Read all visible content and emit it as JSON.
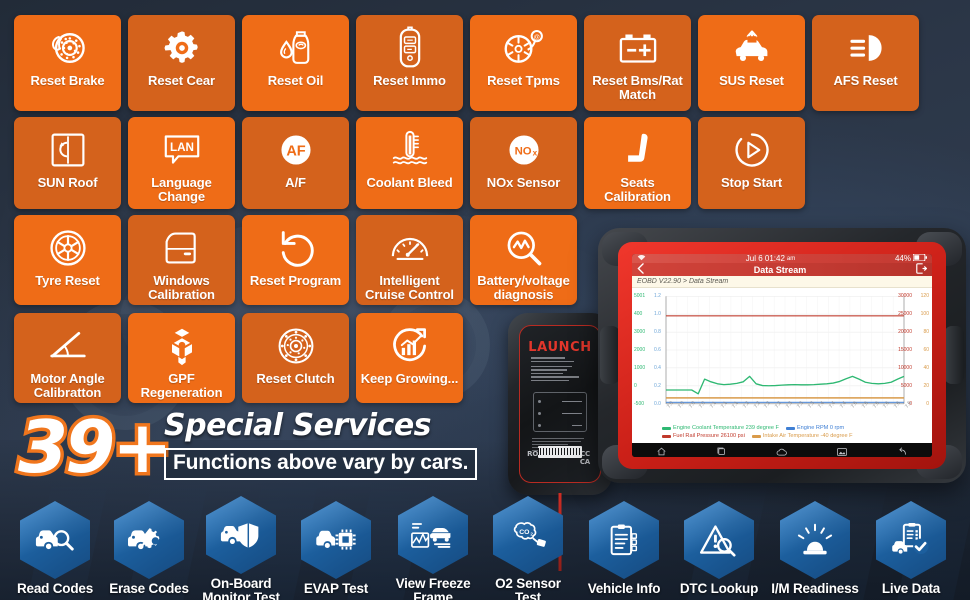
{
  "banner": {
    "count": "39+",
    "title": "Special Services",
    "note": "Functions above vary by cars."
  },
  "colors": {
    "tile_orange_light": "#ef6c17",
    "tile_orange_dark": "#d4621c",
    "hex_blue": "#1c5f9e",
    "brand_red": "#e2362b",
    "background_navy": "#2b3647"
  },
  "special_services": {
    "rows": [
      [
        {
          "label": "Reset Brake",
          "icon": "brake-disc-icon",
          "shade": "a"
        },
        {
          "label": "Reset Cear",
          "icon": "gear-icon",
          "shade": "b"
        },
        {
          "label": "Reset Oil",
          "icon": "oil-bottle-icon",
          "shade": "a"
        },
        {
          "label": "Reset Immo",
          "icon": "key-fob-icon",
          "shade": "b"
        },
        {
          "label": "Reset Tpms",
          "icon": "tyre-pressure-icon",
          "shade": "a"
        },
        {
          "label": "Reset Bms/Rat Match",
          "icon": "battery-icon",
          "shade": "b"
        },
        {
          "label": "SUS Reset",
          "icon": "suspension-car-icon",
          "shade": "a"
        },
        {
          "label": "AFS Reset",
          "icon": "headlight-icon",
          "shade": "b"
        }
      ],
      [
        {
          "label": "SUN Roof",
          "icon": "sunroof-icon",
          "shade": "b"
        },
        {
          "label": "Language Change",
          "icon": "lan-bubble-icon",
          "shade": "a"
        },
        {
          "label": "A/F",
          "icon": "af-circle-icon",
          "shade": "b"
        },
        {
          "label": "Coolant Bleed",
          "icon": "coolant-thermometer-icon",
          "shade": "a"
        },
        {
          "label": "NOx Sensor",
          "icon": "nox-circle-icon",
          "shade": "b"
        },
        {
          "label": "Seats Calibration",
          "icon": "car-seat-icon",
          "shade": "a"
        },
        {
          "label": "Stop Start",
          "icon": "stop-start-icon",
          "shade": "b"
        }
      ],
      [
        {
          "label": "Tyre Reset",
          "icon": "wheel-icon",
          "shade": "a"
        },
        {
          "label": "Windows Calibration",
          "icon": "car-door-icon",
          "shade": "b"
        },
        {
          "label": "Reset Program",
          "icon": "undo-arrow-icon",
          "shade": "a"
        },
        {
          "label": "Intelligent Cruise Control",
          "icon": "speedometer-icon",
          "shade": "b"
        },
        {
          "label": "Battery/voltage diagnosis",
          "icon": "magnifier-pulse-icon",
          "shade": "a"
        }
      ],
      [
        {
          "label": "Motor Angle Calibratton",
          "icon": "angle-icon",
          "shade": "b"
        },
        {
          "label": "GPF Regeneration",
          "icon": "cube-particles-icon",
          "shade": "a"
        },
        {
          "label": "Reset Clutch",
          "icon": "clutch-disc-icon",
          "shade": "b"
        },
        {
          "label": "Keep Growing...",
          "icon": "growth-chart-icon",
          "shade": "a"
        }
      ]
    ]
  },
  "obd_functions": [
    {
      "label": "Read Codes",
      "icon": "car-magnifier-icon"
    },
    {
      "label": "Erase Codes",
      "icon": "car-gear-icon"
    },
    {
      "label": "On-Board Monitor Test",
      "icon": "car-shield-icon"
    },
    {
      "label": "EVAP Test",
      "icon": "car-chip-icon"
    },
    {
      "label": "View Freeze Frame",
      "icon": "freeze-frame-icon"
    },
    {
      "label": "O2 Sensor Test",
      "icon": "co2-sensor-icon"
    },
    {
      "label": "Vehicle Info",
      "icon": "clipboard-icon"
    },
    {
      "label": "DTC Lookup",
      "icon": "warning-magnifier-icon"
    },
    {
      "label": "I/M Readiness",
      "icon": "beacon-lamp-icon"
    },
    {
      "label": "Live Data",
      "icon": "clipboard-check-car-icon"
    }
  ],
  "vci": {
    "brand": "LAUNCH",
    "model_line": "Model: DBScar VII",
    "type_line": "Automotive Diagnostic Terminal",
    "spec_lines": [
      "Working Environment: -10°c-50°c",
      "Working Voltage: 9-18V DC",
      "Working Current: ≤ 150mA",
      "Dimension: 71.8.3mm*46.5mm*22mm",
      "FCC ID: 2AJSM9DBSCAR7"
    ],
    "port_labels": [
      "POWER",
      "VEHICLE",
      "4G"
    ],
    "cert": "ROHS UK CE FCC CA",
    "footer": "LAUNCH TECH CO., LTD.  Copyright ©2021 LAUNCH TECH CO., LTD.  All rights reserved.  http://www.cnlaunch.com  Made in China"
  },
  "tablet": {
    "status": {
      "time": "Jul 6  01:42",
      "ampm": "am",
      "battery": "44%",
      "wifi": "wifi-icon"
    },
    "titlebar": {
      "back": "back-chevron-icon",
      "title": "Data Stream",
      "exit": "exit-icon"
    },
    "breadcrumb": "EOBD V22.90 > Data Stream",
    "navbar": [
      "home-icon",
      "recents-icon",
      "cloud-icon",
      "screenshot-icon",
      "back-icon"
    ],
    "chart_data": {
      "type": "line",
      "title": "Data Stream",
      "xlabel": "",
      "ylabel": "",
      "grid": true,
      "legend_position": "bottom",
      "left_axis_outer": {
        "ticks": [
          "5001",
          "400",
          "3000",
          "2000",
          "1000",
          "0",
          "-500"
        ],
        "range": [
          -500,
          5001
        ]
      },
      "left_axis_inner": {
        "ticks": [
          "1.2",
          "1.0",
          "0.8",
          "0.6",
          "0.4",
          "0.2",
          "0.0"
        ],
        "range": [
          0.0,
          1.2
        ]
      },
      "right_axis_outer": {
        "ticks": [
          "30000",
          "25000",
          "20000",
          "15000",
          "10000",
          "5000",
          "0"
        ],
        "range": [
          0,
          30000
        ]
      },
      "right_axis_inner": {
        "ticks": [
          "120",
          "100",
          "80",
          "60",
          "40",
          "20",
          "0"
        ],
        "range": [
          0,
          120
        ]
      },
      "x": [
        "7.0",
        "7.0",
        "7.0",
        "7.0",
        "7.1",
        "7.1",
        "7.1",
        "7.2",
        "7.2",
        "7.2",
        "7.2",
        "7.3",
        "7.3",
        "7.3",
        "7.4",
        "7.4",
        "7.4",
        "7.5",
        "7.5",
        "7.5",
        "7.6",
        "7.6"
      ],
      "series": [
        {
          "name": "Engine Coolant Temperature 239 degree F",
          "color": "#2eb872",
          "values": [
            205,
            205,
            205,
            205,
            205,
            10,
            760,
            620,
            520,
            480,
            500,
            540,
            620,
            900,
            520,
            430,
            420,
            430,
            450,
            470,
            480,
            470,
            470,
            480,
            500,
            520,
            560,
            640,
            780,
            900,
            760,
            600,
            540,
            520,
            540,
            600,
            760,
            900
          ]
        },
        {
          "name": "Engine RPM 0 rpm",
          "color": "#3f7fd4",
          "values": [
            0,
            0,
            0,
            0,
            0,
            0,
            0,
            0,
            0,
            0,
            0,
            0,
            0,
            0,
            0,
            0,
            0,
            0,
            0,
            0,
            0,
            0
          ]
        },
        {
          "name": "Fuel Rail Pressure 26100 psi",
          "color": "#c0392b",
          "values": [
            25000,
            25000,
            25000,
            25000,
            25000,
            25000,
            25000,
            25000,
            25000,
            25000,
            25000,
            25000,
            25000,
            25000,
            25000,
            25000,
            25000,
            25000,
            25000,
            25000,
            25000,
            25000
          ]
        },
        {
          "name": "Intake Air Temperature -40 degree F",
          "color": "#d99b4a",
          "values": [
            -40,
            -40,
            -40,
            -40,
            -40,
            -40,
            -40,
            -40,
            -40,
            -40,
            -40,
            -40,
            -40,
            -40,
            -40,
            -40,
            -40,
            -40,
            -40,
            -40,
            -40,
            -40
          ]
        }
      ],
      "x_ticks": [
        "7.0",
        "7.0",
        "7.0",
        "7.0",
        "7.1",
        "7.1",
        "7.1",
        "7.2",
        "7.2",
        "7.2",
        "7.2",
        "7.3",
        "7.3",
        "7.3",
        "7.4",
        "7.4",
        "7.4",
        "7.5",
        "7.5",
        "7.5",
        "7.6",
        "7.6",
        "7.6"
      ]
    }
  }
}
